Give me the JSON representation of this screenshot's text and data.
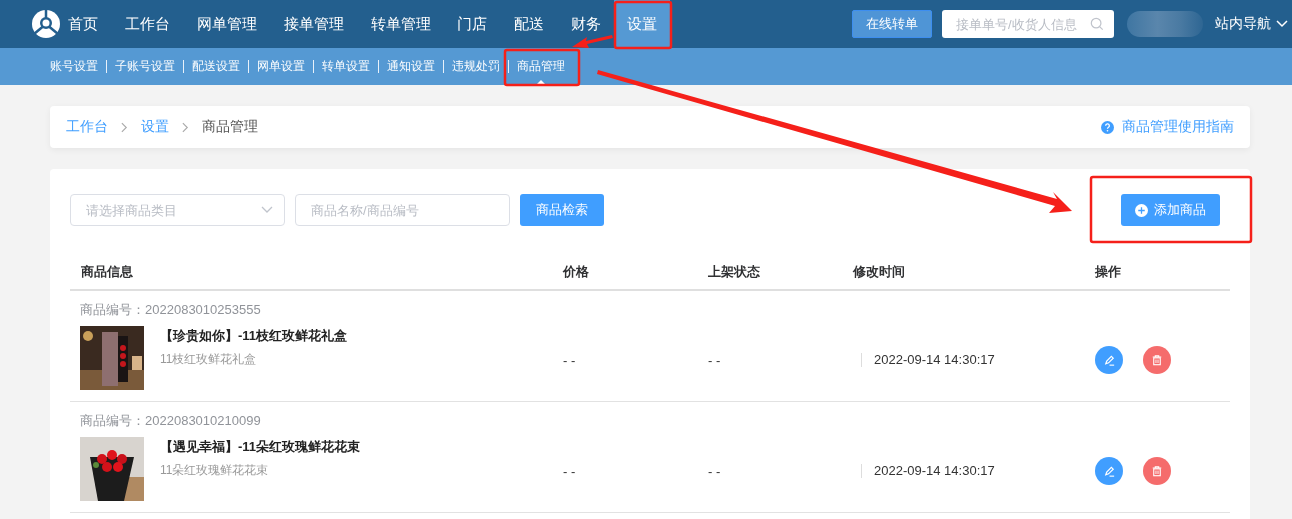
{
  "nav": {
    "items": [
      {
        "label": "首页",
        "selected": false
      },
      {
        "label": "工作台",
        "selected": false
      },
      {
        "label": "网单管理",
        "selected": false
      },
      {
        "label": "接单管理",
        "selected": false
      },
      {
        "label": "转单管理",
        "selected": false
      },
      {
        "label": "门店",
        "selected": false
      },
      {
        "label": "配送",
        "selected": false
      },
      {
        "label": "财务",
        "selected": false
      },
      {
        "label": "设置",
        "selected": true
      }
    ],
    "online_transfer_button": "在线转单",
    "search": {
      "placeholder": "接单单号/收货人信息"
    },
    "site_nav": "站内导航"
  },
  "subnav": [
    {
      "label": "账号设置",
      "selected": false
    },
    {
      "label": "子账号设置",
      "selected": false
    },
    {
      "label": "配送设置",
      "selected": false
    },
    {
      "label": "网单设置",
      "selected": false
    },
    {
      "label": "转单设置",
      "selected": false
    },
    {
      "label": "通知设置",
      "selected": false
    },
    {
      "label": "违规处罚",
      "selected": false
    },
    {
      "label": "商品管理",
      "selected": true
    }
  ],
  "breadcrumb": [
    "工作台",
    "设置",
    "商品管理"
  ],
  "guide_link": "商品管理使用指南",
  "filters": {
    "category": {
      "placeholder": "请选择商品类目"
    },
    "keyword": {
      "placeholder": "商品名称/商品编号"
    },
    "search_button": "商品检索"
  },
  "add_button": "添加商品",
  "table": {
    "columns": [
      "商品信息",
      "价格",
      "上架状态",
      "修改时间",
      "操作"
    ],
    "rows": [
      {
        "code": "商品编号：2022083010253555",
        "title": "【珍贵如你】-11枝红玫鲜花礼盒",
        "subtitle": "11枝红玫鲜花礼盒",
        "price": "- -",
        "status": "- -",
        "modified": "2022-09-14 14:30:17"
      },
      {
        "code": "商品编号：2022083010210099",
        "title": "【遇见幸福】-11朵红玫瑰鲜花花束",
        "subtitle": "11朵红玫瑰鲜花花束",
        "price": "- -",
        "status": "- -",
        "modified": "2022-09-14 14:30:17"
      }
    ]
  }
}
